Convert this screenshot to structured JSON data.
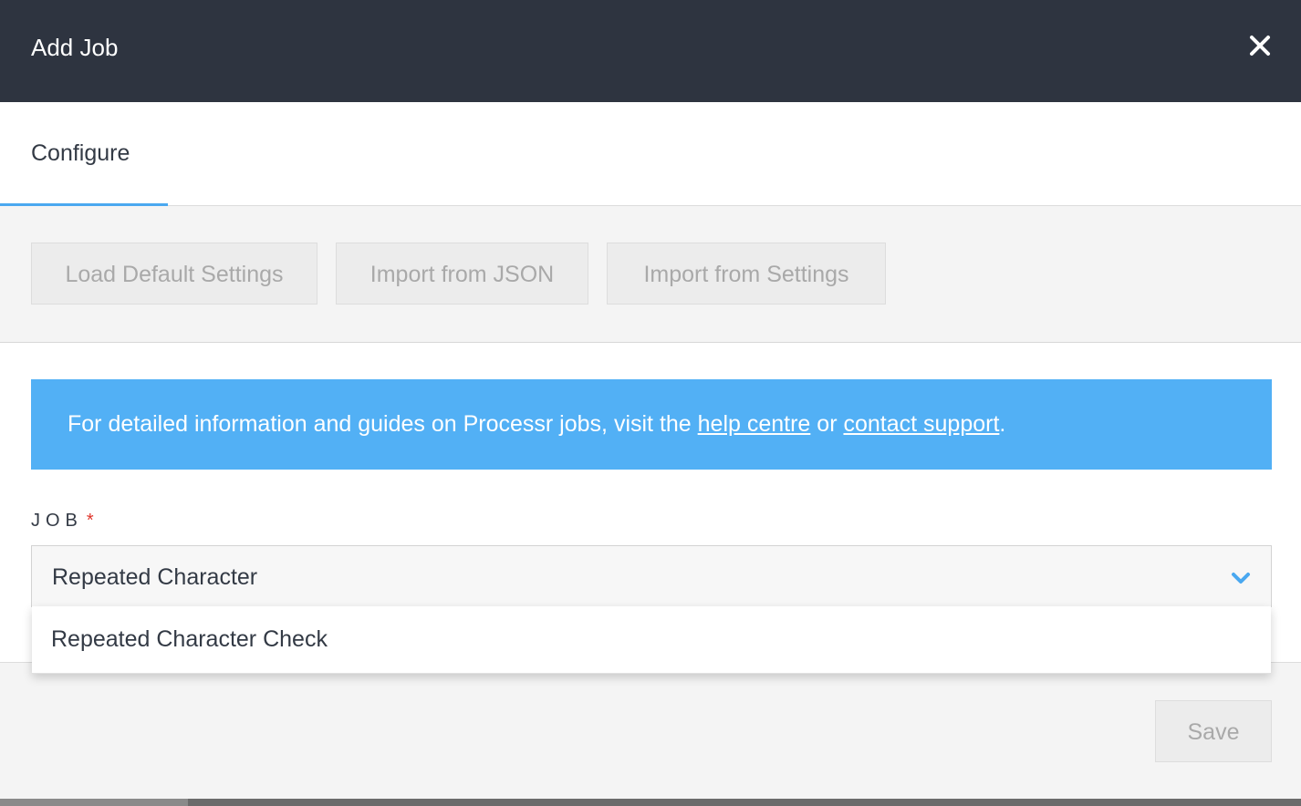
{
  "window": {
    "title": "Add Job",
    "close_icon": "close-icon"
  },
  "tabs": [
    {
      "label": "Configure",
      "active": true
    }
  ],
  "toolbar": {
    "load_default_label": "Load Default Settings",
    "import_json_label": "Import from JSON",
    "import_settings_label": "Import from Settings"
  },
  "info_banner": {
    "text_before": "For detailed information and guides on Processr jobs, visit the ",
    "help_link": "help centre",
    "text_middle": " or ",
    "support_link": "contact support",
    "text_after": ".",
    "color": "#52b0f5"
  },
  "job_field": {
    "label": "JOB",
    "required_mark": "*",
    "value": "Repeated Character",
    "chevron_icon": "chevron-down-icon",
    "options": [
      {
        "label": "Repeated Character Check"
      }
    ]
  },
  "footer": {
    "save_label": "Save"
  },
  "colors": {
    "header_bg": "#2e3440",
    "accent": "#4aa8f0",
    "required": "#e0352b"
  }
}
